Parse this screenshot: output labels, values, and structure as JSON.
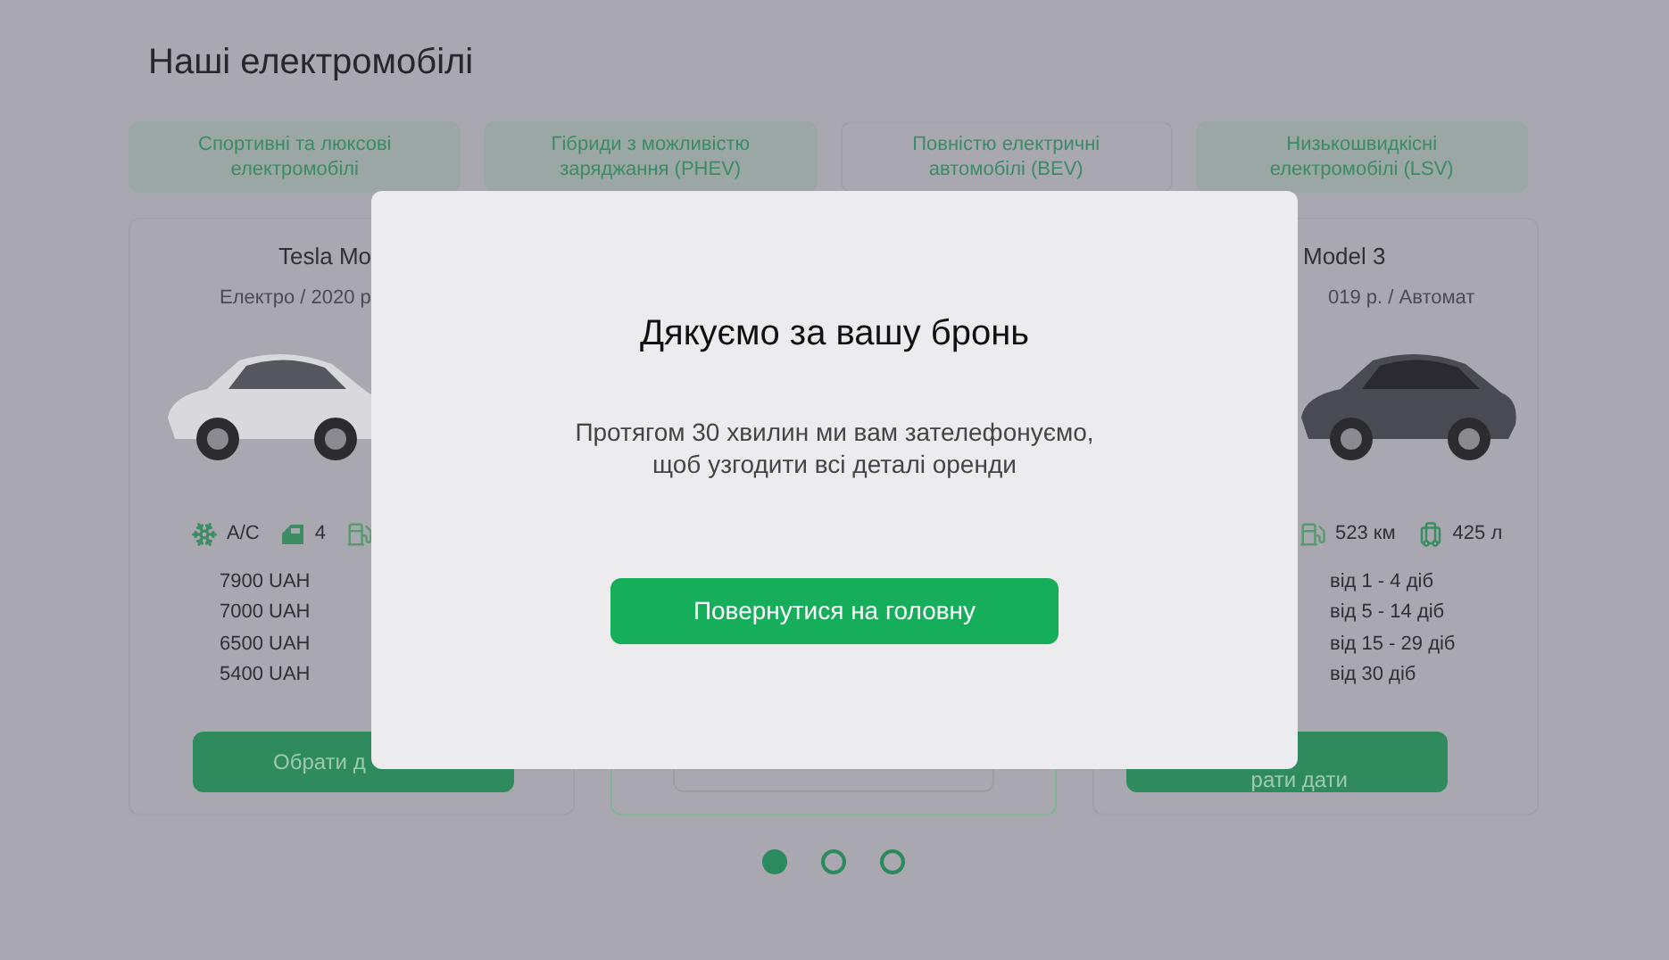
{
  "page_title": "Наші електромобілі",
  "categories": [
    {
      "label": "Спортивні та люксові електромобілі",
      "selected": false
    },
    {
      "label": "Гібриди з можливістю заряджання (PHEV)",
      "selected": false
    },
    {
      "label": "Повністю електричні автомобілі (BEV)",
      "selected": true
    },
    {
      "label": "Низькошвидкісні електромобілі (LSV)",
      "selected": false
    }
  ],
  "cars": [
    {
      "kind": "left",
      "selected": false,
      "title": "Tesla Mo",
      "subtitle": "Електро / 2020 р",
      "features": [
        {
          "kind": "ac",
          "text": "A/C"
        },
        {
          "kind": "door",
          "text": "4"
        },
        {
          "kind": "charge"
        }
      ],
      "prices": [
        "7900 UAH",
        "7000 UAH",
        "6500 UAH",
        "5400 UAH"
      ],
      "button": "Обрати д"
    },
    {
      "kind": "hidden",
      "selected": true
    },
    {
      "kind": "right",
      "selected": false,
      "title": "Model 3",
      "subtitle": "019 р. / Автомат",
      "features": [
        {
          "kind": "charge",
          "text": "523 км"
        },
        {
          "kind": "luggage",
          "text": "425 л"
        }
      ],
      "terms": [
        "від 1 - 4 діб",
        "від 5 - 14 діб",
        "від 15 - 29 діб",
        "від 30 діб"
      ],
      "button": "рати дати"
    }
  ],
  "modal": {
    "title": "Дякуємо за вашу бронь",
    "message": "Протягом 30 хвилин ми вам зателефонуємо,\nщоб узгодити всі деталі оренди",
    "button": "Повернутися на головну"
  },
  "pagination": [
    {
      "selected": true
    },
    {
      "selected": false
    },
    {
      "selected": false
    }
  ]
}
